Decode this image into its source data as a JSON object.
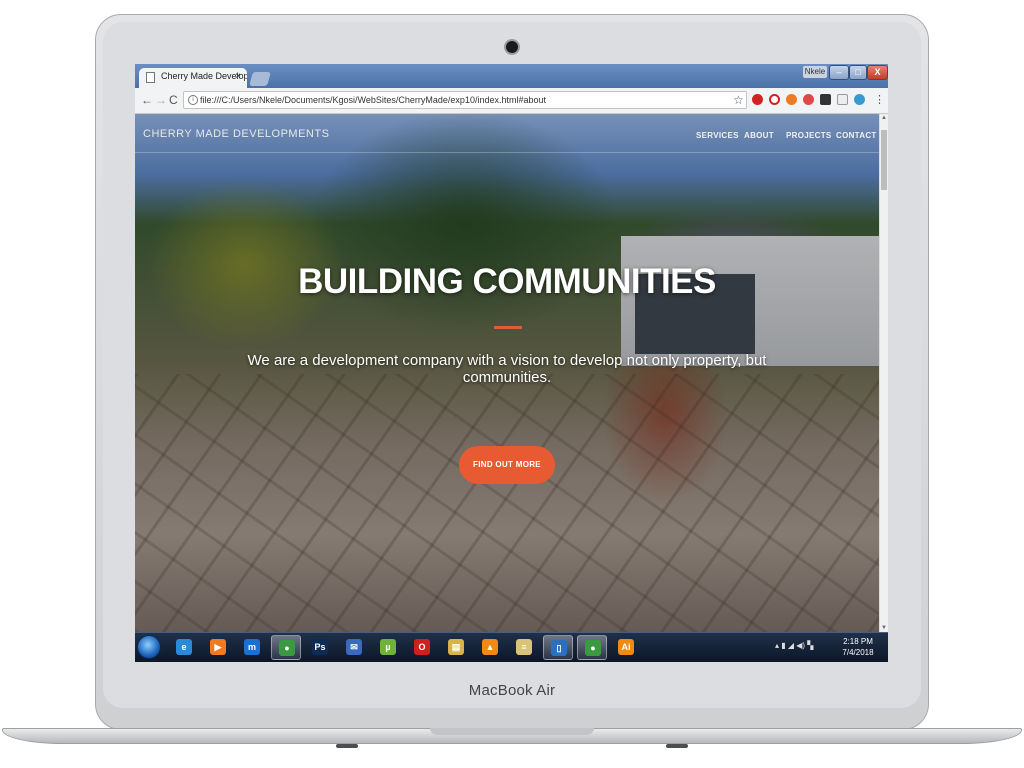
{
  "device": {
    "brand_label": "MacBook Air"
  },
  "browser": {
    "tab_title": "Cherry Made Developme",
    "tab_close": "×",
    "user_label": "Nkele",
    "window_controls": {
      "minimize": "–",
      "maximize": "□",
      "close": "X"
    },
    "nav": {
      "back": "←",
      "forward": "→",
      "reload": "C"
    },
    "address": "file:///C:/Users/Nkele/Documents/Kgosi/WebSites/CherryMade/exp10/index.html#about",
    "star": "☆",
    "extensions": [
      "adblock-icon",
      "opera-icon",
      "honey-icon",
      "pocket-icon",
      "extension-icon",
      "gmail-icon",
      "chrome-icon",
      "menu-icon"
    ]
  },
  "site": {
    "brand": "CHERRY MADE DEVELOPMENTS",
    "nav_links": [
      "SERVICES",
      "ABOUT",
      "PROJECTS",
      "CONTACT"
    ],
    "hero": {
      "title": "BUILDING COMMUNITIES",
      "subtitle": "We are a development company with a vision to develop not only property, but communities.",
      "cta": "FIND OUT MORE"
    },
    "colors": {
      "accent": "#e85a32"
    }
  },
  "taskbar": {
    "items": [
      {
        "icon": "internet-explorer-icon",
        "glyph": "e",
        "color": "#2a8ad8"
      },
      {
        "icon": "media-player-icon",
        "glyph": "▶",
        "color": "#f07a20"
      },
      {
        "icon": "maxthon-icon",
        "glyph": "m",
        "color": "#1f6fd0"
      },
      {
        "icon": "chrome-icon",
        "glyph": "●",
        "color": "#3a9a40",
        "active": true
      },
      {
        "icon": "photoshop-icon",
        "glyph": "Ps",
        "color": "#0d2b55"
      },
      {
        "icon": "thunderbird-icon",
        "glyph": "✉",
        "color": "#3a6ac0"
      },
      {
        "icon": "utorrent-icon",
        "glyph": "µ",
        "color": "#6fb33a"
      },
      {
        "icon": "opera-icon",
        "glyph": "O",
        "color": "#d0201c"
      },
      {
        "icon": "folder-icon",
        "glyph": "▤",
        "color": "#d9b34a"
      },
      {
        "icon": "vlc-icon",
        "glyph": "▲",
        "color": "#f08a10"
      },
      {
        "icon": "notes-icon",
        "glyph": "≡",
        "color": "#d9c27a"
      },
      {
        "icon": "tablet-icon",
        "glyph": "▯",
        "color": "#2b6fc0",
        "active": true
      },
      {
        "icon": "chrome-icon",
        "glyph": "●",
        "color": "#3a9a40",
        "active": true
      },
      {
        "icon": "illustrator-icon",
        "glyph": "Ai",
        "color": "#f08a10"
      }
    ],
    "tray": "▴ ▮ ◢ ◀) ▚",
    "clock_time": "2:18 PM",
    "clock_date": "7/4/2018"
  }
}
